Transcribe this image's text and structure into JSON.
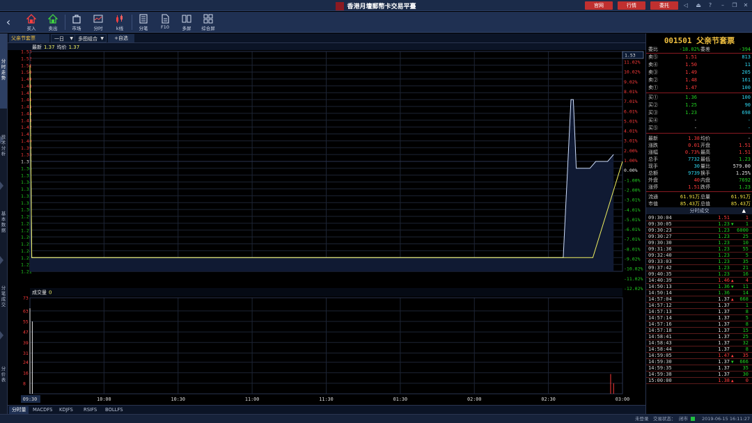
{
  "titlebar": {
    "title": "香港月壇郵幣卡交易平臺",
    "buttons": [
      "官网",
      "行情",
      "委托"
    ]
  },
  "toolbar": {
    "items": [
      "买入",
      "卖出",
      "市场",
      "分时",
      "k线",
      "分笔",
      "F10",
      "多屏",
      "综合屏"
    ]
  },
  "leftnav": [
    "分时走势",
    "技术分析",
    "基本数据",
    "分笔成交",
    "分价表"
  ],
  "chart_header": {
    "stock": "父亲节套票",
    "period": "一日",
    "combo": "多图组合",
    "add": "+自选",
    "info_latest_label": "最新",
    "info_latest": "1.37",
    "info_avg_label": "均价",
    "info_avg": "1.37",
    "vol_label": "成交量",
    "vol_value": "0"
  },
  "chart_data": {
    "type": "line",
    "price_axis": [
      "1.53",
      "1.52",
      "1.51",
      "1.50",
      "1.49",
      "1.48",
      "1.47",
      "1.46",
      "1.45",
      "1.44",
      "1.43",
      "1.42",
      "1.41",
      "1.40",
      "1.39",
      "1.38",
      "1.37",
      "1.36",
      "1.35",
      "1.34",
      "1.33",
      "1.32",
      "1.31",
      "1.30",
      "1.29",
      "1.28",
      "1.27",
      "1.26",
      "1.25",
      "1.24",
      "1.23",
      "1.22",
      "1.21"
    ],
    "pct_axis": [
      "11.02%",
      "10.02%",
      "9.02%",
      "8.01%",
      "7.01%",
      "6.01%",
      "5.01%",
      "4.01%",
      "3.01%",
      "2.00%",
      "1.00%",
      "0.00%",
      "-1.00%",
      "-2.00%",
      "-3.01%",
      "-4.01%",
      "-5.01%",
      "-6.01%",
      "-7.01%",
      "-8.01%",
      "-9.02%",
      "-10.02%",
      "-11.02%",
      "-12.02%"
    ],
    "ylim": [
      1.21,
      1.53
    ],
    "prev_close": 1.37,
    "current_price_tag": "1.53",
    "time_labels": [
      "09:30",
      "10:00",
      "10:30",
      "11:00",
      "11:30",
      "01:30",
      "02:00",
      "02:30",
      "03:00"
    ],
    "price_series": [
      {
        "t": 0.0,
        "v": 1.51
      },
      {
        "t": 0.003,
        "v": 1.23
      },
      {
        "t": 0.9,
        "v": 1.23
      },
      {
        "t": 0.913,
        "v": 1.46
      },
      {
        "t": 0.917,
        "v": 1.46
      },
      {
        "t": 0.922,
        "v": 1.36
      },
      {
        "t": 0.945,
        "v": 1.36
      },
      {
        "t": 0.955,
        "v": 1.37
      },
      {
        "t": 0.975,
        "v": 1.37
      },
      {
        "t": 0.985,
        "v": 1.38
      }
    ],
    "avg_series": [
      {
        "t": 0.0,
        "v": 1.51
      },
      {
        "t": 0.003,
        "v": 1.23
      },
      {
        "t": 0.95,
        "v": 1.23
      },
      {
        "t": 1.0,
        "v": 1.37
      }
    ],
    "volume_axis": [
      "73",
      "63",
      "55",
      "47",
      "39",
      "31",
      "24",
      "16",
      "8"
    ],
    "volume_ylim": [
      0,
      73
    ],
    "volume_bars": [
      {
        "t": 0.0,
        "v": 65
      },
      {
        "t": 0.004,
        "v": 55
      },
      {
        "t": 0.98,
        "v": 15
      },
      {
        "t": 0.985,
        "v": 8
      }
    ]
  },
  "bottom_tabs": [
    "分时量",
    "MACDFS",
    "KDJFS",
    "RSIFS",
    "BOLLFS"
  ],
  "statusbar": {
    "login": "未登录",
    "trade_state_label": "交易状态：",
    "trade_state": "闭市",
    "datetime": "2019-06-15 16:11:27"
  },
  "quote": {
    "code_name": "001501 父亲节套票",
    "weibi_label": "委比",
    "weibi": "-18.02%",
    "weicha_label": "委差",
    "weicha": "-394",
    "asks": [
      {
        "label": "卖⑤",
        "price": "1.51",
        "vol": "813"
      },
      {
        "label": "卖④",
        "price": "1.50",
        "vol": "11"
      },
      {
        "label": "卖③",
        "price": "1.49",
        "vol": "205"
      },
      {
        "label": "卖②",
        "price": "1.48",
        "vol": "161"
      },
      {
        "label": "卖①",
        "price": "1.47",
        "vol": "100"
      }
    ],
    "bids": [
      {
        "label": "买①",
        "price": "1.36",
        "vol": "100"
      },
      {
        "label": "买②",
        "price": "1.25",
        "vol": "90"
      },
      {
        "label": "买③",
        "price": "1.23",
        "vol": "698"
      },
      {
        "label": "买④",
        "price": "-",
        "vol": "-"
      },
      {
        "label": "买⑤",
        "price": "-",
        "vol": "-"
      }
    ],
    "stats": [
      {
        "l1": "最新",
        "v1": "1.38",
        "c1": "red",
        "l2": "均价",
        "v2": "-",
        "c2": "white"
      },
      {
        "l1": "涨跌",
        "v1": "0.01",
        "c1": "red",
        "l2": "开盘",
        "v2": "1.51",
        "c2": "red"
      },
      {
        "l1": "涨幅",
        "v1": "0.73%",
        "c1": "red",
        "l2": "最高",
        "v2": "1.51",
        "c2": "red"
      },
      {
        "l1": "总手",
        "v1": "7732",
        "c1": "cyan",
        "l2": "最低",
        "v2": "1.23",
        "c2": "green"
      },
      {
        "l1": "现手",
        "v1": "30",
        "c1": "cyan",
        "l2": "量比",
        "v2": "579.00",
        "c2": "white"
      },
      {
        "l1": "总额",
        "v1": "9739",
        "c1": "cyan",
        "l2": "换手",
        "v2": "1.25%",
        "c2": "white"
      },
      {
        "l1": "外盘",
        "v1": "40",
        "c1": "red",
        "l2": "内盘",
        "v2": "7692",
        "c2": "green"
      },
      {
        "l1": "涨停",
        "v1": "1.51",
        "c1": "red",
        "l2": "跌停",
        "v2": "1.23",
        "c2": "green"
      }
    ],
    "cap": [
      {
        "l1": "流通",
        "v1": "61.91万",
        "l2": "总量",
        "v2": "61.91万"
      },
      {
        "l1": "市值",
        "v1": "85.43万",
        "l2": "总值",
        "v2": "85.43万"
      }
    ],
    "ticks_title": "分时成交",
    "ticks": [
      {
        "t": "09:30:04",
        "p": "1.51",
        "pc": "red",
        "a": "",
        "v": "1",
        "vc": "red"
      },
      {
        "t": "09:30:05",
        "p": "1.23",
        "pc": "green",
        "a": "▼",
        "ac": "green",
        "v": "1",
        "vc": "green"
      },
      {
        "t": "09:30:23",
        "p": "1.23",
        "pc": "green",
        "a": "",
        "v": "6000",
        "vc": "green"
      },
      {
        "t": "09:30:27",
        "p": "1.23",
        "pc": "green",
        "a": "",
        "v": "25",
        "vc": "green"
      },
      {
        "t": "09:30:30",
        "p": "1.23",
        "pc": "green",
        "a": "",
        "v": "10",
        "vc": "green"
      },
      {
        "t": "09:31:36",
        "p": "1.23",
        "pc": "green",
        "a": "",
        "v": "55",
        "vc": "green"
      },
      {
        "t": "09:32:40",
        "p": "1.23",
        "pc": "green",
        "a": "",
        "v": "5",
        "vc": "green"
      },
      {
        "t": "09:33:03",
        "p": "1.23",
        "pc": "green",
        "a": "",
        "v": "35",
        "vc": "green"
      },
      {
        "t": "09:37:42",
        "p": "1.23",
        "pc": "green",
        "a": "",
        "v": "21",
        "vc": "green"
      },
      {
        "t": "09:40:35",
        "p": "1.23",
        "pc": "green",
        "a": "",
        "v": "16",
        "vc": "green"
      },
      {
        "t": "14:40:39",
        "p": "1.46",
        "pc": "red",
        "a": "▲",
        "ac": "red",
        "v": "4",
        "vc": "red"
      },
      {
        "t": "14:50:13",
        "p": "1.36",
        "pc": "green",
        "a": "▼",
        "ac": "green",
        "v": "11",
        "vc": "green"
      },
      {
        "t": "14:50:14",
        "p": "1.36",
        "pc": "green",
        "a": "",
        "v": "14",
        "vc": "green"
      },
      {
        "t": "14:57:04",
        "p": "1.37",
        "pc": "white",
        "a": "▲",
        "ac": "red",
        "v": "668",
        "vc": "green"
      },
      {
        "t": "14:57:12",
        "p": "1.37",
        "pc": "white",
        "a": "",
        "v": "1",
        "vc": "green"
      },
      {
        "t": "14:57:13",
        "p": "1.37",
        "pc": "white",
        "a": "",
        "v": "8",
        "vc": "green"
      },
      {
        "t": "14:57:14",
        "p": "1.37",
        "pc": "white",
        "a": "",
        "v": "5",
        "vc": "green"
      },
      {
        "t": "14:57:16",
        "p": "1.37",
        "pc": "white",
        "a": "",
        "v": "8",
        "vc": "green"
      },
      {
        "t": "14:57:18",
        "p": "1.37",
        "pc": "white",
        "a": "",
        "v": "15",
        "vc": "green"
      },
      {
        "t": "14:58:41",
        "p": "1.37",
        "pc": "white",
        "a": "",
        "v": "25",
        "vc": "green"
      },
      {
        "t": "14:58:43",
        "p": "1.37",
        "pc": "white",
        "a": "",
        "v": "32",
        "vc": "green"
      },
      {
        "t": "14:58:44",
        "p": "1.37",
        "pc": "white",
        "a": "",
        "v": "8",
        "vc": "green"
      },
      {
        "t": "14:59:05",
        "p": "1.47",
        "pc": "red",
        "a": "▲",
        "ac": "red",
        "v": "35",
        "vc": "red"
      },
      {
        "t": "14:59:30",
        "p": "1.37",
        "pc": "white",
        "a": "▼",
        "ac": "green",
        "v": "666",
        "vc": "green"
      },
      {
        "t": "14:59:35",
        "p": "1.37",
        "pc": "white",
        "a": "",
        "v": "35",
        "vc": "green"
      },
      {
        "t": "14:59:38",
        "p": "1.37",
        "pc": "white",
        "a": "",
        "v": "30",
        "vc": "green"
      },
      {
        "t": "15:00:00",
        "p": "1.38",
        "pc": "red",
        "a": "▲",
        "ac": "red",
        "v": "0",
        "vc": "red"
      }
    ]
  },
  "colors": {
    "price_line": "#d0e0ff",
    "avg_line": "#f0f060",
    "grid": "#1d2434",
    "axis_red": "#ff3b3b",
    "axis_green": "#22d022"
  }
}
